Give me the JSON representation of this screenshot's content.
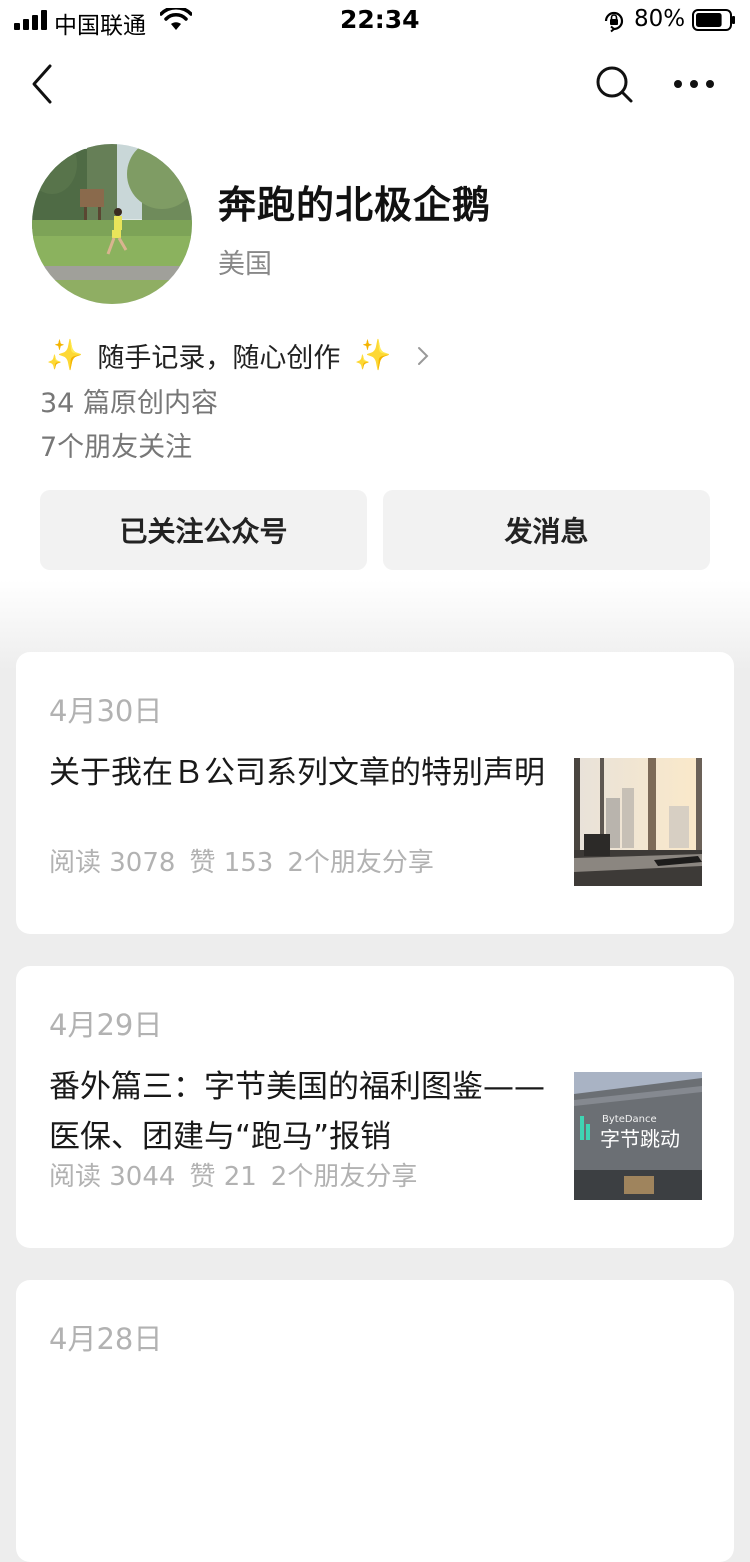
{
  "status_bar": {
    "carrier": "中国联通",
    "time": "22:34",
    "battery_percent": "80%",
    "battery_level": 0.8
  },
  "nav": {
    "back_icon": "chevron-left-icon",
    "search_icon": "search-icon",
    "more_icon": "more-dots-icon"
  },
  "profile": {
    "name": "奔跑的北极企鹅",
    "region": "美国",
    "signature": "随手记录，随心创作",
    "signature_emoji": "✨",
    "original_count": "34 篇原创内容",
    "friends_following": "7个朋友关注"
  },
  "actions": {
    "follow_label": "已关注公众号",
    "message_label": "发消息"
  },
  "articles": [
    {
      "date": "4月30日",
      "title": "关于我在Ｂ公司系列文章的特别声明",
      "reads": "阅读 3078",
      "likes": "赞 153",
      "shares": "2个朋友分享"
    },
    {
      "date": "4月29日",
      "title": "番外篇三：字节美国的福利图鉴——医保、团建与“跑马”报销",
      "reads": "阅读 3044",
      "likes": "赞 21",
      "shares": "2个朋友分享",
      "thumb_logo_en": "ByteDance",
      "thumb_logo_cn": "字节跳动"
    },
    {
      "date": "4月28日"
    }
  ],
  "colors": {
    "page_bg": "#ededed",
    "card_bg": "#ffffff",
    "muted_text": "#b2b2b2",
    "button_bg": "#f2f2f2",
    "bytedance_accent": "#3fd5b3"
  }
}
